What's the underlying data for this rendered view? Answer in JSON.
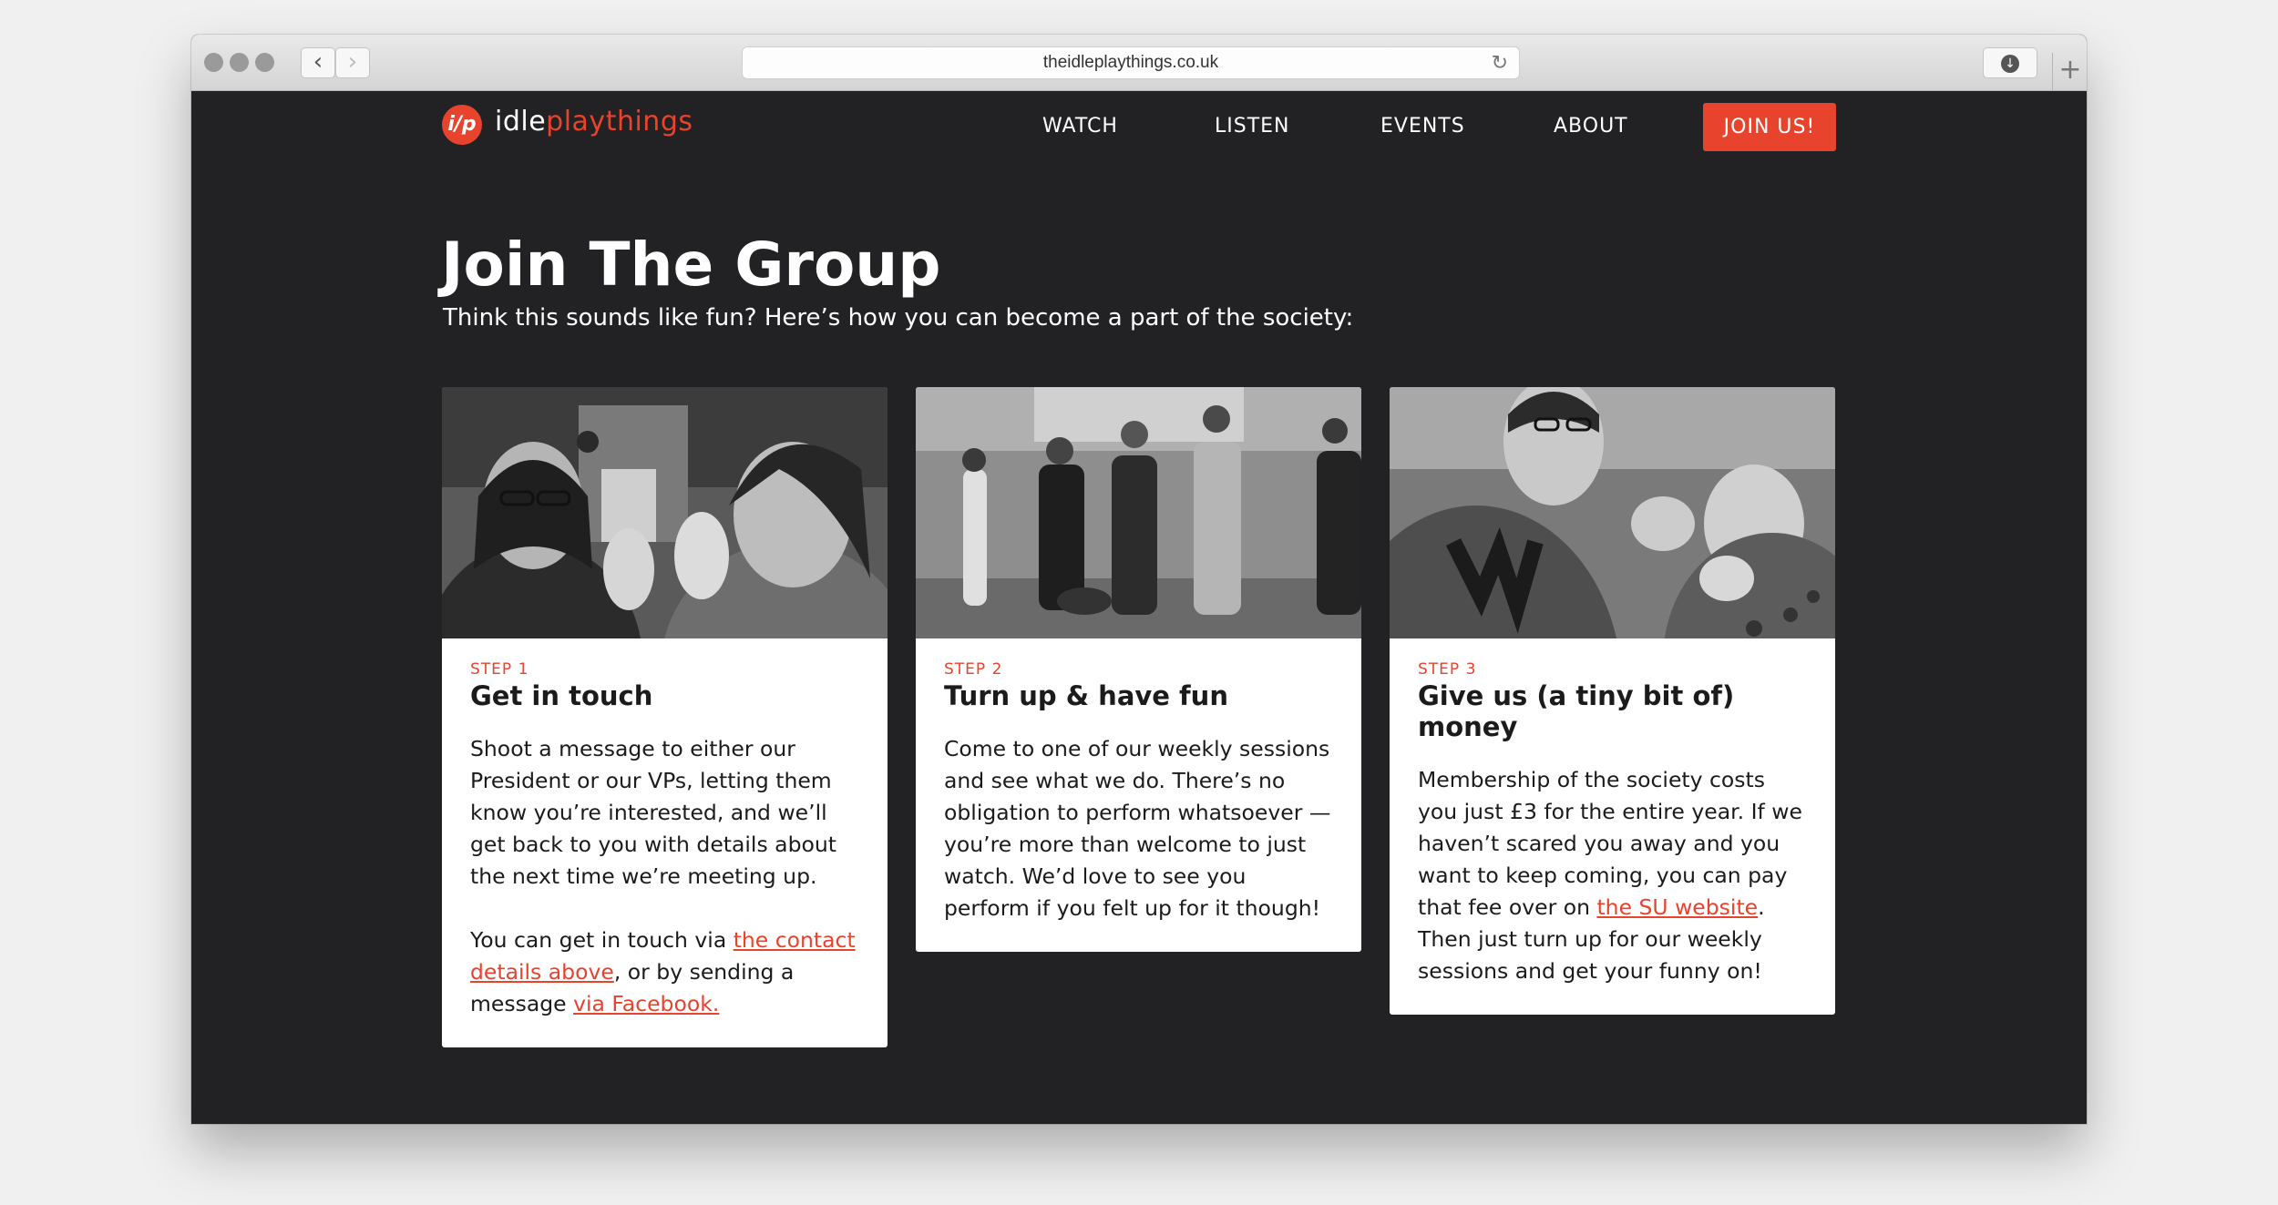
{
  "browser": {
    "url": "theidleplaythings.co.uk"
  },
  "header": {
    "logo_mark": "i/p",
    "logo_plain": "idle",
    "logo_accent": "playthings",
    "nav": [
      "WATCH",
      "LISTEN",
      "EVENTS",
      "ABOUT"
    ],
    "cta": "JOIN US!"
  },
  "main": {
    "title": "Join The Group",
    "subtitle": "Think this sounds like fun? Here’s how you can become a part of the society:",
    "steps": [
      {
        "label": "STEP 1",
        "title": "Get in touch",
        "text": "Shoot a message to either our President or our VPs, letting them know you’re interested, and we’ll get back to you with details about the next time we’re meeting up.",
        "text2_pre": "You can get in touch via ",
        "text2_link1": "the contact details above",
        "text2_mid": ", or by sending a message ",
        "text2_link2": "via Facebook."
      },
      {
        "label": "STEP 2",
        "title": "Turn up & have fun",
        "text": "Come to one of our weekly sessions and see what we do. There’s no obligation to perform whatsoever — you’re more than welcome to just watch. We’d love to see you perform if you felt up for it though!"
      },
      {
        "label": "STEP 3",
        "title": "Give us (a tiny bit of) money",
        "text_pre": "Membership of the society costs you just £3 for the entire year. If we haven’t scared you away and you want to keep coming, you can pay that fee over on ",
        "text_link": "the SU website",
        "text_post": ". Then just turn up for our weekly sessions and get your funny on!"
      }
    ]
  },
  "colors": {
    "accent": "#e8432d",
    "page_bg": "#222123",
    "card_bg": "#ffffff"
  },
  "icons": [
    "back-chevron-icon",
    "forward-chevron-icon",
    "reload-icon",
    "download-icon",
    "new-tab-icon"
  ]
}
